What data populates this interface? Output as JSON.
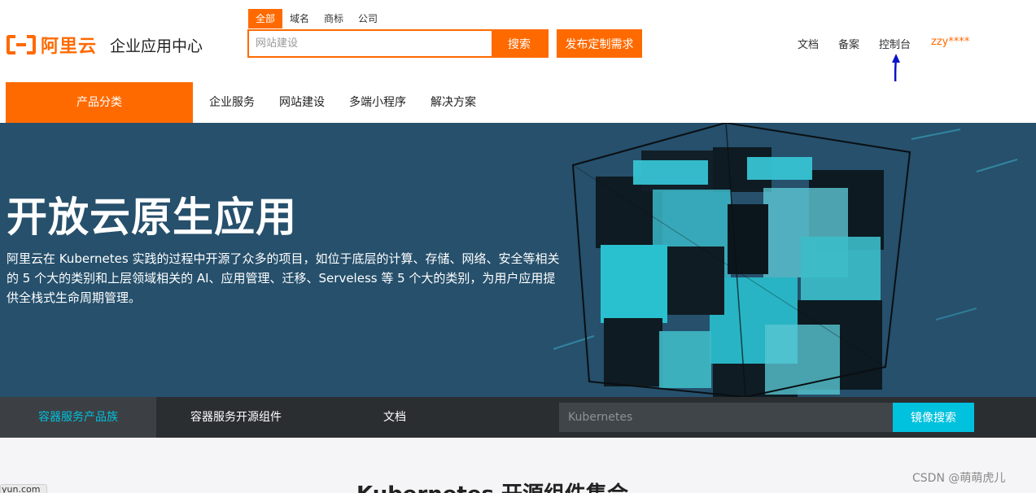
{
  "header": {
    "logo_brand": "阿里云",
    "logo_subtitle": "企业应用中心",
    "search_tabs": [
      "全部",
      "域名",
      "商标",
      "公司"
    ],
    "active_search_tab": 0,
    "search_placeholder": "网站建设",
    "search_button": "搜索",
    "publish_button": "发布定制需求",
    "links": {
      "docs": "文档",
      "filing": "备案",
      "console": "控制台",
      "user": "zzy****"
    }
  },
  "nav": {
    "category_label": "产品分类",
    "items": [
      "企业服务",
      "网站建设",
      "多端小程序",
      "解决方案"
    ]
  },
  "banner": {
    "title": "开放云原生应用",
    "description": "阿里云在 Kubernetes 实践的过程中开源了众多的项目，如位于底层的计算、存储、网络、安全等相关的 5 个大的类别和上层领域相关的 AI、应用管理、迁移、Serveless 等 5 个大的类别，为用户应用提供全栈式生命周期管理。"
  },
  "sub_nav": {
    "tabs": [
      "容器服务产品族",
      "容器服务开源组件",
      "文档"
    ],
    "active_tab": 0,
    "mirror_search_placeholder": "Kubernetes",
    "mirror_search_button": "镜像搜索"
  },
  "section": {
    "title": "Kubernetes 开源组件集合"
  },
  "status_fragment": "yun.com",
  "watermark": "CSDN @萌萌虎儿",
  "colors": {
    "brand_orange": "#ff6a00",
    "banner_bg": "#26506c",
    "subnav_bg": "#2b2e31",
    "accent_cyan": "#00c1de",
    "annotation_arrow": "#0a14c8"
  }
}
